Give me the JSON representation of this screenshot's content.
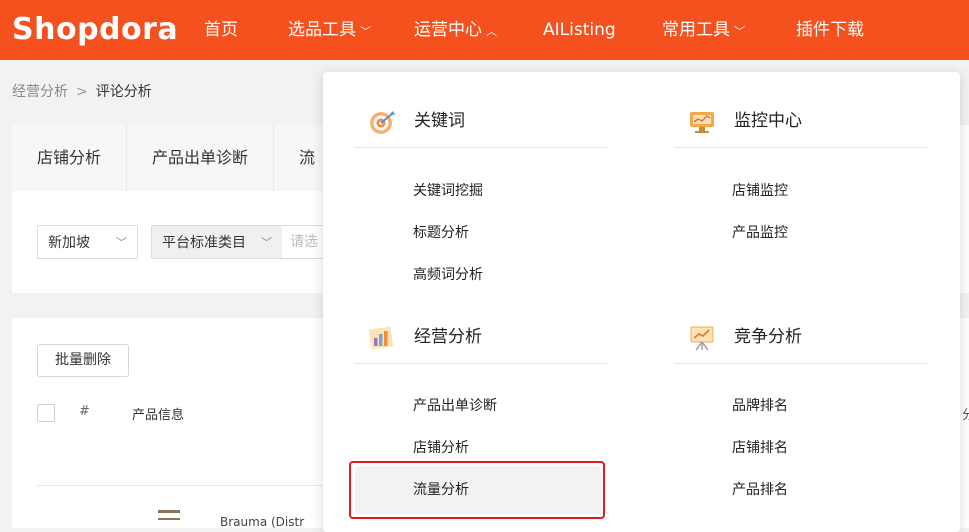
{
  "header": {
    "logo_text": "Shopdora",
    "nav": [
      {
        "label": "首页",
        "chevron": ""
      },
      {
        "label": "选品工具",
        "chevron": "﹀"
      },
      {
        "label": "运营中心",
        "chevron": "︿"
      },
      {
        "label": "AIListing",
        "chevron": ""
      },
      {
        "label": "常用工具",
        "chevron": "﹀"
      },
      {
        "label": "插件下载",
        "chevron": ""
      }
    ]
  },
  "breadcrumb": {
    "parent": "经营分析",
    "separator": ">",
    "current": "评论分析"
  },
  "tabs": [
    "店铺分析",
    "产品出单诊断",
    "流"
  ],
  "filters": {
    "region": "新加坡",
    "category_type": "平台标准类目",
    "category_placeholder": "请选",
    "chevron": "﹀"
  },
  "list": {
    "batch_delete_label": "批量删除",
    "col_hash": "#",
    "col_product_info": "产品信息",
    "col_right_partial": "分",
    "row_text_partial": "Brauma (Distr"
  },
  "dropdown": {
    "categories": [
      {
        "title": "关键词",
        "icon": "target-icon",
        "items": [
          "关键词挖掘",
          "标题分析",
          "高频词分析"
        ]
      },
      {
        "title": "监控中心",
        "icon": "monitor-icon",
        "items": [
          "店铺监控",
          "产品监控"
        ]
      },
      {
        "title": "经营分析",
        "icon": "bar-chart-icon",
        "items": [
          "产品出单诊断",
          "店铺分析",
          "流量分析"
        ]
      },
      {
        "title": "竞争分析",
        "icon": "presentation-icon",
        "items": [
          "品牌排名",
          "店铺排名",
          "产品排名"
        ]
      }
    ],
    "highlighted_item": "流量分析"
  },
  "colors": {
    "brand": "#f4511e",
    "highlight_border": "#e8191c"
  }
}
